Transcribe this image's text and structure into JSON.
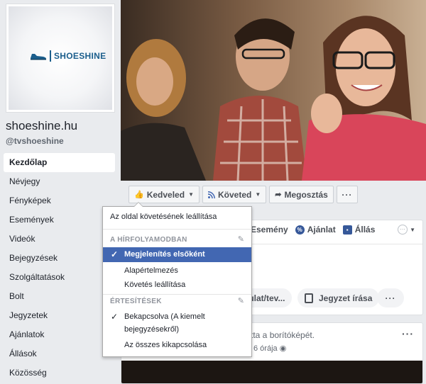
{
  "sidebar": {
    "logo_text": "SHOESHINE",
    "page_name": "shoeshine.hu",
    "page_handle": "@tvshoeshine",
    "nav": [
      {
        "label": "Kezdőlap"
      },
      {
        "label": "Névjegy"
      },
      {
        "label": "Fényképek"
      },
      {
        "label": "Események"
      },
      {
        "label": "Videók"
      },
      {
        "label": "Bejegyzések"
      },
      {
        "label": "Szolgáltatások"
      },
      {
        "label": "Bolt"
      },
      {
        "label": "Jegyzetek"
      },
      {
        "label": "Ajánlatok"
      },
      {
        "label": "Állások"
      },
      {
        "label": "Közösség"
      }
    ]
  },
  "action_bar": {
    "like_label": "Kedveled",
    "follow_label": "Követed",
    "share_label": "Megosztás",
    "more_label": "···"
  },
  "composer": {
    "event_label": "Esemény",
    "offer_label": "Ajánlat",
    "job_label": "Állás",
    "pill_1_label": "nulat/tev...",
    "pill_2_label": "Jegyzet írása",
    "pill_3_label": "···"
  },
  "post": {
    "text": "tatta a borítóképét.",
    "meta": "6 órája",
    "dots": "···"
  },
  "dropdown": {
    "unfollow": "Az oldal követésének leállítása",
    "section_feed": "A HÍRFOLYAMODBAN",
    "see_first": "Megjelenítés elsőként",
    "default": "Alapértelmezés",
    "unfollow_short": "Követés leállítása",
    "section_notifications": "ÉRTESÍTÉSEK",
    "on_line1": "Bekapcsolva (A kiemelt",
    "on_line2": "bejegyzésekről)",
    "all_off": "Az összes kikapcsolása"
  },
  "colors": {
    "accent": "#4267b2",
    "brand_blue": "#1b5e8c",
    "background": "#e9ebee"
  }
}
